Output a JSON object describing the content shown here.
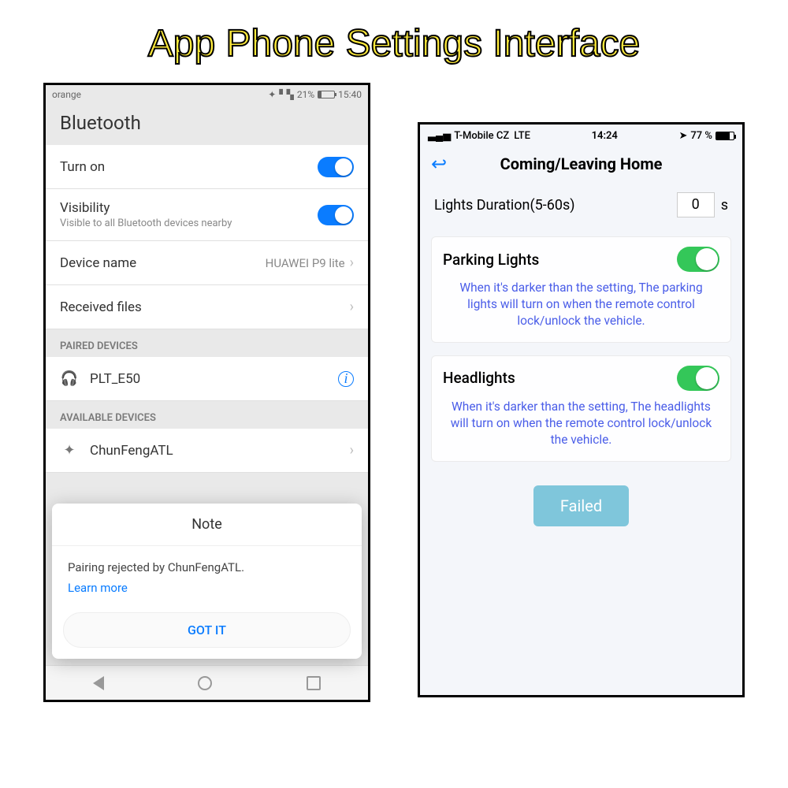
{
  "page_title": "App Phone Settings Interface",
  "android": {
    "status": {
      "carrier": "orange",
      "battery_pct": "21%",
      "time": "15:40"
    },
    "header": "Bluetooth",
    "turn_on": {
      "label": "Turn on",
      "on": true
    },
    "visibility": {
      "label": "Visibility",
      "sub": "Visible to all Bluetooth devices nearby",
      "on": true
    },
    "device_name": {
      "label": "Device name",
      "value": "HUAWEI P9 lite"
    },
    "received": {
      "label": "Received files"
    },
    "section_paired": "PAIRED DEVICES",
    "paired": [
      {
        "name": "PLT_E50"
      }
    ],
    "section_available": "AVAILABLE DEVICES",
    "available": [
      {
        "name": "ChunFengATL"
      }
    ],
    "dialog": {
      "title": "Note",
      "body": "Pairing rejected by ChunFengATL.",
      "link": "Learn more",
      "button": "GOT IT"
    }
  },
  "ios": {
    "status": {
      "carrier": "T-Mobile CZ",
      "net": "LTE",
      "time": "14:24",
      "battery_pct": "77 %"
    },
    "title": "Coming/Leaving Home",
    "duration": {
      "label": "Lights Duration(5-60s)",
      "value": "0",
      "unit": "s"
    },
    "parking": {
      "title": "Parking Lights",
      "on": true,
      "desc": "When it's darker than the setting, The parking lights will turn on when the remote control lock/unlock the vehicle."
    },
    "headlights": {
      "title": "Headlights",
      "on": true,
      "desc": "When it's darker than the setting, The headlights will turn on when the remote control lock/unlock the vehicle."
    },
    "fail_button": "Failed"
  }
}
